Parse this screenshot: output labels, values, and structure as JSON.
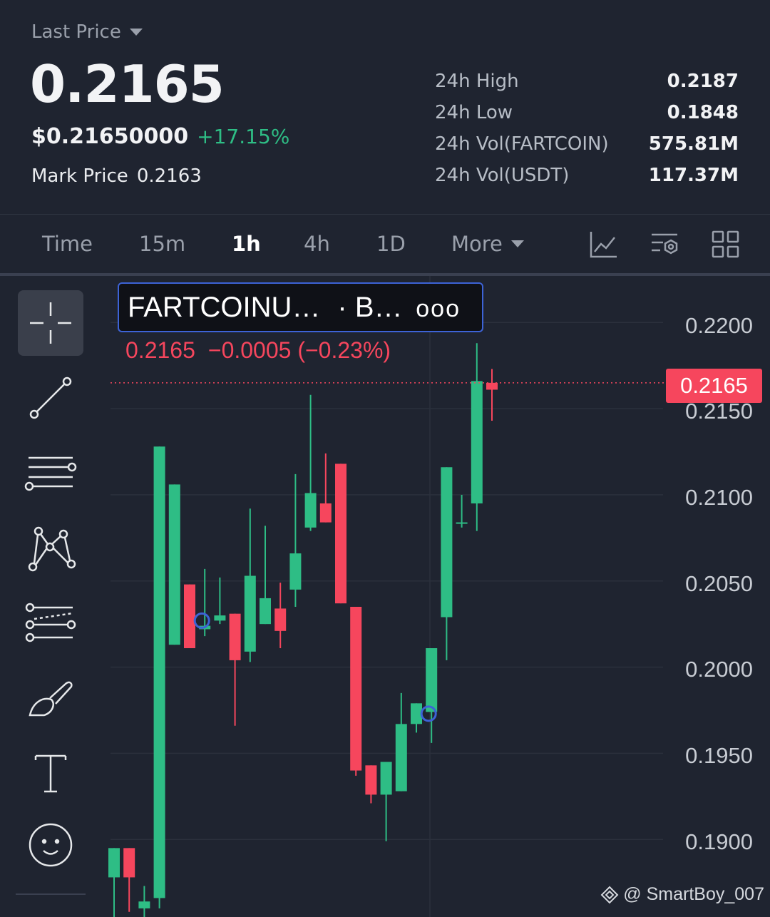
{
  "header": {
    "last_price_label": "Last Price",
    "last_price": "0.2165",
    "usd_price": "$0.21650000",
    "change_pct": "+17.15%",
    "mark_price_label": "Mark Price",
    "mark_price": "0.2163",
    "stats": [
      {
        "label": "24h High",
        "value": "0.2187"
      },
      {
        "label": "24h Low",
        "value": "0.1848"
      },
      {
        "label": "24h Vol(FARTCOIN)",
        "value": "575.81M"
      },
      {
        "label": "24h Vol(USDT)",
        "value": "117.37M"
      }
    ]
  },
  "intervals": {
    "items": [
      "Time",
      "15m",
      "1h",
      "4h",
      "1D"
    ],
    "active": "1h",
    "more_label": "More",
    "tool_icons": [
      "indicators-icon",
      "chart-settings-icon",
      "layout-grid-icon"
    ]
  },
  "drawing_tools": [
    "crosshair-icon",
    "trend-line-icon",
    "horizontal-lines-icon",
    "pattern-icon",
    "fib-channel-icon",
    "brush-icon",
    "text-icon",
    "emoji-icon"
  ],
  "chart": {
    "symbol": "FARTCOINU…",
    "exchange": "· B…",
    "menu_label": "ooo",
    "ohlc_close": "0.2165",
    "ohlc_change": "−0.0005 (−0.23%)",
    "current_price_tag": "0.2165",
    "watermark": "@ SmartBoy_007",
    "colors": {
      "up": "#2ebd85",
      "down": "#f6465d",
      "grid": "#2b303c",
      "marker": "#3d63d6"
    }
  },
  "chart_data": {
    "type": "candlestick",
    "interval": "1h",
    "y_ticks": [
      "0.2200",
      "0.2150",
      "0.2100",
      "0.2050",
      "0.2000",
      "0.1950",
      "0.1900"
    ],
    "ylim": [
      0.1855,
      0.2227
    ],
    "last_price_line": 0.2165,
    "candles": [
      {
        "o": 0.1878,
        "h": 0.1887,
        "l": 0.1855,
        "c": 0.1895
      },
      {
        "o": 0.1895,
        "h": 0.188,
        "l": 0.1858,
        "c": 0.1878
      },
      {
        "o": 0.186,
        "h": 0.1873,
        "l": 0.1855,
        "c": 0.1864
      },
      {
        "o": 0.1866,
        "h": 0.2085,
        "l": 0.186,
        "c": 0.2128
      },
      {
        "o": 0.2013,
        "h": 0.2048,
        "l": 0.2084,
        "c": 0.2106
      },
      {
        "o": 0.2048,
        "h": 0.204,
        "l": 0.2022,
        "c": 0.2011
      },
      {
        "o": 0.2022,
        "h": 0.2057,
        "l": 0.2018,
        "c": 0.2024
      },
      {
        "o": 0.2027,
        "h": 0.2025,
        "l": 0.2052,
        "c": 0.203
      },
      {
        "o": 0.2031,
        "h": 0.2011,
        "l": 0.1966,
        "c": 0.2004
      },
      {
        "o": 0.2009,
        "h": 0.2092,
        "l": 0.2003,
        "c": 0.2053
      },
      {
        "o": 0.2025,
        "h": 0.2066,
        "l": 0.2082,
        "c": 0.204
      },
      {
        "o": 0.2034,
        "h": 0.2049,
        "l": 0.2011,
        "c": 0.2021
      },
      {
        "o": 0.2045,
        "h": 0.2112,
        "l": 0.2035,
        "c": 0.2066
      },
      {
        "o": 0.2081,
        "h": 0.2158,
        "l": 0.2079,
        "c": 0.2101
      },
      {
        "o": 0.2095,
        "h": 0.2124,
        "l": 0.2103,
        "c": 0.2084
      },
      {
        "o": 0.2118,
        "h": 0.2114,
        "l": 0.2076,
        "c": 0.2037
      },
      {
        "o": 0.2035,
        "h": 0.1937,
        "l": 0.1938,
        "c": 0.194
      },
      {
        "o": 0.1943,
        "h": 0.1937,
        "l": 0.1921,
        "c": 0.1926
      },
      {
        "o": 0.1926,
        "h": 0.1908,
        "l": 0.1899,
        "c": 0.1945
      },
      {
        "o": 0.1928,
        "h": 0.1985,
        "l": 0.1934,
        "c": 0.1967
      },
      {
        "o": 0.1967,
        "h": 0.1962,
        "l": 0.1972,
        "c": 0.1979
      },
      {
        "o": 0.1974,
        "h": 0.1984,
        "l": 0.1956,
        "c": 0.2011
      },
      {
        "o": 0.2029,
        "h": 0.2059,
        "l": 0.2004,
        "c": 0.2116
      },
      {
        "o": 0.2084,
        "h": 0.21,
        "l": 0.2081,
        "c": 0.2084
      },
      {
        "o": 0.2095,
        "h": 0.2188,
        "l": 0.2079,
        "c": 0.2166
      },
      {
        "o": 0.2165,
        "h": 0.2173,
        "l": 0.2143,
        "c": 0.2161
      }
    ],
    "markers": [
      {
        "candle_index": 6,
        "price": 0.2027
      },
      {
        "candle_index": 21,
        "price": 0.1973
      }
    ]
  }
}
